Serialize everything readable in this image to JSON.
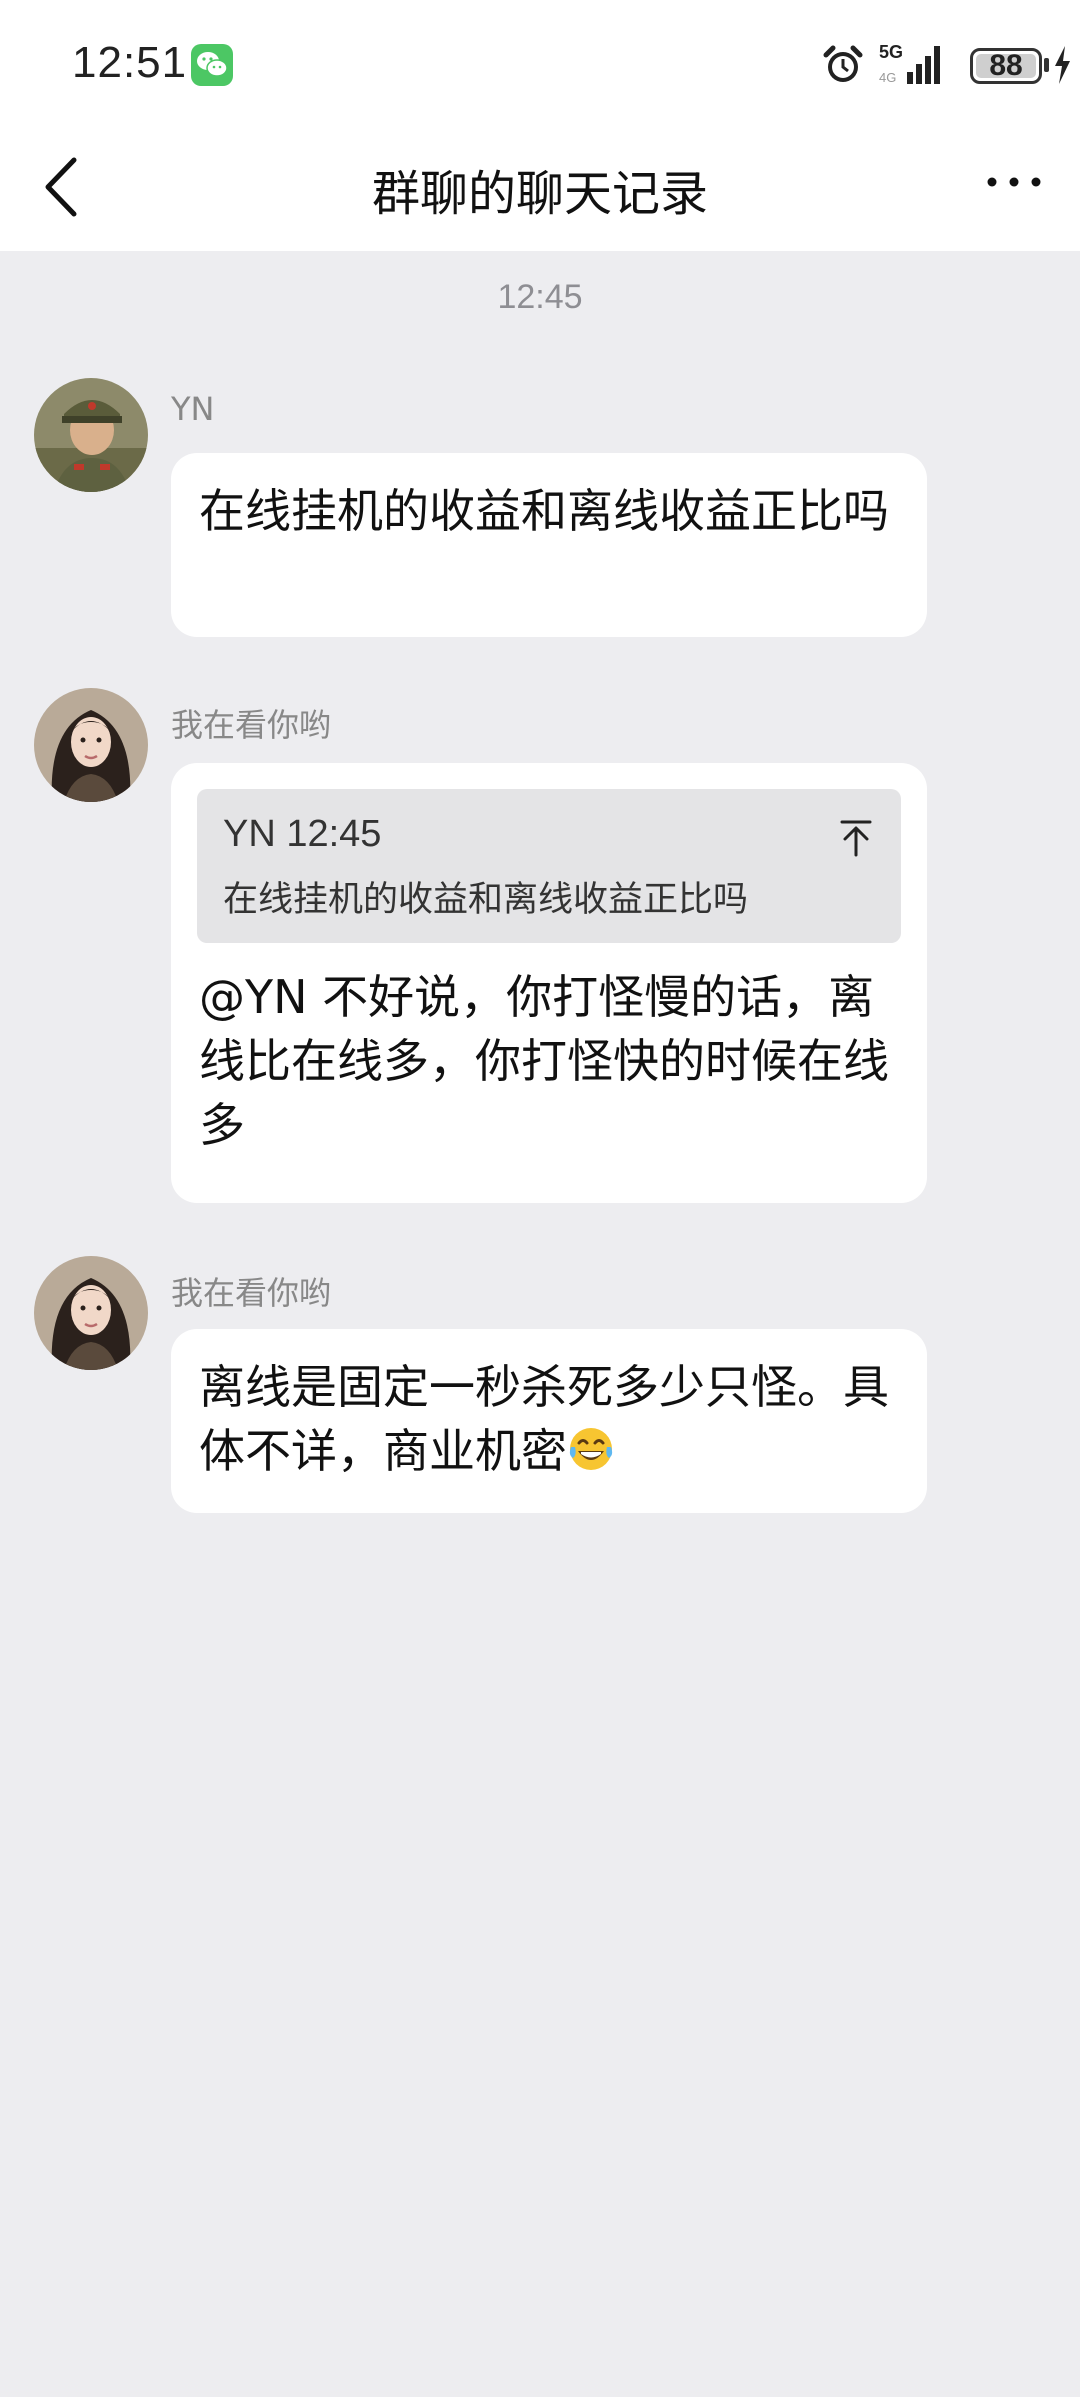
{
  "status_bar": {
    "time": "12:51",
    "network": "5G",
    "battery": "88",
    "icons": [
      "wechat-icon",
      "alarm-icon",
      "signal-icon",
      "battery-icon",
      "charging-icon"
    ]
  },
  "header": {
    "title": "群聊的聊天记录",
    "back_icon": "back-icon",
    "more_icon": "more-icon"
  },
  "timestamp": "12:45",
  "messages": [
    {
      "sender": "YN",
      "text": "在线挂机的收益和离线收益正比吗"
    },
    {
      "sender": "我在看你哟",
      "quote": {
        "header": "YN 12:45",
        "text": "在线挂机的收益和离线收益正比吗"
      },
      "text": "@YN 不好说，你打怪慢的话，离线比在线多，你打怪快的时候在线多"
    },
    {
      "sender": "我在看你哟",
      "text": "离线是固定一秒杀死多少只怪。具体不详，商业机密",
      "emoji": "tears-of-joy-emoji"
    }
  ],
  "colors": {
    "background": "#ededf0",
    "bubble": "#ffffff",
    "quote_bg": "#e4e4e6",
    "wechat_green": "#4cc764"
  }
}
